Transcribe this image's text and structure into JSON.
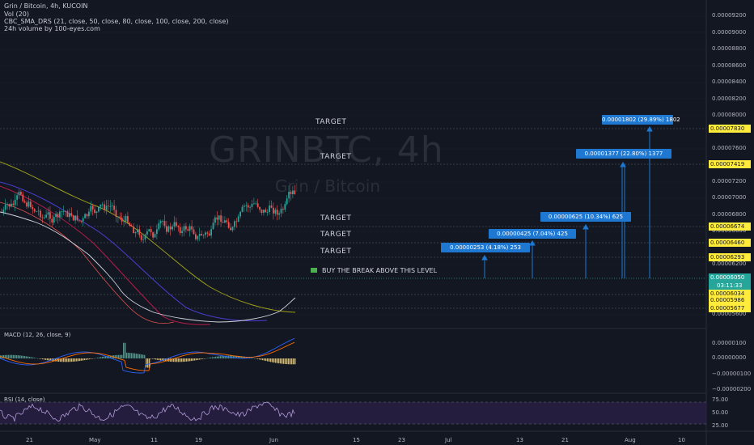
{
  "header": {
    "title": "Grin / Bitcoin, 4h, KUCOIN",
    "vol": "Vol (20)",
    "sma": "CBC_SMA_DRS (21, close, 50, close, 80, close, 100, close, 200, close)",
    "volume24": "24h volume by 100-eyes.com"
  },
  "watermark": {
    "symbol": "GRINBTC, 4h",
    "name": "Grin / Bitcoin"
  },
  "annotations": {
    "targets": [
      "TARGET",
      "TARGET",
      "TARGET",
      "TARGET",
      "TARGET"
    ],
    "boxes": [
      "0.00001802 (29.89%) 1802",
      "0.00001377 (22.80%) 1377",
      "0.00000625 (10.34%) 625",
      "0.00000425 (7.04%) 425",
      "0.00000253 (4.18%) 253"
    ],
    "buy_text": "BUY THE BREAK ABOVE THIS LEVEL"
  },
  "price_axis": {
    "labels": [
      "0.00009200",
      "0.00009000",
      "0.00008800",
      "0.00008600",
      "0.00008400",
      "0.00008200",
      "0.00008000",
      "0.00007600",
      "0.00007200",
      "0.00007000",
      "0.00006800",
      "0.00006600",
      "0.00006200",
      "0.00005600"
    ],
    "badges": {
      "b7830": "0.00007830",
      "b7419": "0.00007419",
      "b6674": "0.00006674",
      "b6460": "0.00006460",
      "b6293": "0.00006293",
      "current": "0.00006050",
      "timer": "03:11:33",
      "b6034": "0.00006034",
      "b5986": "0.00005986",
      "b5677": "0.00005677"
    }
  },
  "macd": {
    "label": "MACD (12, 26, close, 9)",
    "axis": [
      "0.00000100",
      "0.00000000",
      "−0.00000100",
      "−0.00000200"
    ]
  },
  "rsi": {
    "label": "RSI (14, close)",
    "axis": [
      "75.00",
      "50.00",
      "25.00"
    ]
  },
  "time_axis": [
    "21",
    "May",
    "11",
    "19",
    "Jun",
    "15",
    "23",
    "Jul",
    "13",
    "21",
    "Aug",
    "10"
  ],
  "colors": {
    "background": "#131722",
    "box_blue": "#1e78d2",
    "badge_yellow": "#ffeb3b",
    "badge_teal": "#26a69a",
    "up": "#26a69a",
    "down": "#ef5350"
  }
}
